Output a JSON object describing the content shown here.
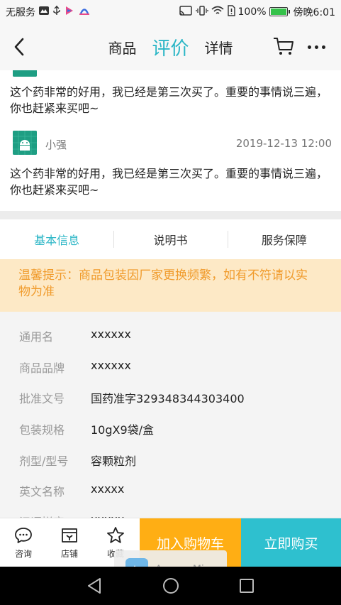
{
  "status_bar": {
    "carrier": "无服务",
    "battery_pct": "100%",
    "time": "傍晚6:01"
  },
  "header": {
    "tabs": [
      "商品",
      "评价",
      "详情"
    ],
    "active_tab": "评价"
  },
  "reviews": [
    {
      "text": "这个药非常的好用，我已经是第三次买了。重要的事情说三遍，你也赶紧来买吧~"
    },
    {
      "user": "小强",
      "date": "2019-12-13 12:00",
      "text": "这个药非常的好用，我已经是第三次买了。重要的事情说三遍，你也赶紧来买吧~"
    }
  ],
  "info_tabs": [
    "基本信息",
    "说明书",
    "服务保障"
  ],
  "notice": "温馨提示：商品包装因厂家更换频繁，如有不符请以实物为准",
  "info_rows": [
    {
      "key": "通用名",
      "value": "xxxxxx"
    },
    {
      "key": "商品品牌",
      "value": "xxxxxx"
    },
    {
      "key": "批准文号",
      "value": "国药准字329348344303400"
    },
    {
      "key": "包装规格",
      "value": "10gX9袋/盒"
    },
    {
      "key": "剂型/型号",
      "value": "容颗粒剂"
    },
    {
      "key": "英文名称",
      "value": "xxxxx"
    },
    {
      "key": "汉语拼音",
      "value": "xxxxx"
    }
  ],
  "bottom_bar": {
    "consult": "咨询",
    "shop": "店铺",
    "favorite": "收藏",
    "add_to_cart": "加入购物车",
    "buy_now": "立即购买"
  },
  "overlay": {
    "app_name": "ApowerMirror"
  },
  "colors": {
    "accent": "#2bb6c6",
    "cart_button": "#ffae14",
    "buy_button": "#2ec0cf",
    "notice_bg": "#fde9c6",
    "notice_text": "#f09a2a"
  }
}
